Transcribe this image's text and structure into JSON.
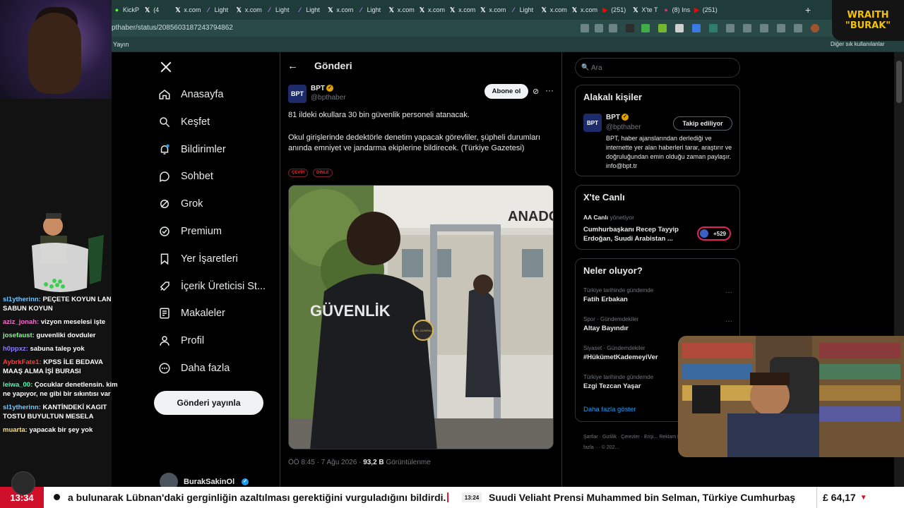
{
  "browser": {
    "tabs": [
      {
        "label": "KickP",
        "icon": "kick-icon",
        "color": "#53fc18"
      },
      {
        "label": "(4",
        "icon": "x-icon",
        "color": "#ffffff"
      },
      {
        "label": "x.com",
        "icon": "x-icon",
        "color": "#ffffff"
      },
      {
        "label": "Light",
        "icon": "feather-icon",
        "color": "#b38cff"
      },
      {
        "label": "x.com",
        "icon": "x-icon",
        "color": "#ffffff"
      },
      {
        "label": "Light",
        "icon": "feather-icon",
        "color": "#b38cff"
      },
      {
        "label": "Light",
        "icon": "feather-icon",
        "color": "#b38cff"
      },
      {
        "label": "x.com",
        "icon": "x-icon",
        "color": "#ffffff"
      },
      {
        "label": "Light",
        "icon": "feather-icon",
        "color": "#b38cff"
      },
      {
        "label": "x.com",
        "icon": "x-icon",
        "color": "#ffffff"
      },
      {
        "label": "x.com",
        "icon": "x-icon",
        "color": "#ffffff"
      },
      {
        "label": "x.com",
        "icon": "x-icon",
        "color": "#ffffff"
      },
      {
        "label": "x.com",
        "icon": "x-icon",
        "color": "#ffffff"
      },
      {
        "label": "Light",
        "icon": "feather-icon",
        "color": "#b38cff"
      },
      {
        "label": "x.com",
        "icon": "x-icon",
        "color": "#ffffff"
      },
      {
        "label": "x.com",
        "icon": "x-icon",
        "color": "#ffffff"
      },
      {
        "label": "(251)",
        "icon": "youtube-icon",
        "color": "#ff0000"
      },
      {
        "label": "X'te T",
        "icon": "x-icon",
        "color": "#ffffff"
      },
      {
        "label": "(8) Ins",
        "icon": "instagram-icon",
        "color": "#e1306c"
      },
      {
        "label": "(251)",
        "icon": "youtube-icon",
        "color": "#ff0000"
      }
    ],
    "new_tab": "+",
    "url": "pthaber/status/2085603187243794862",
    "bookmark_left": "Yayın",
    "bookmark_right": "Diğer sık kullanılanlar"
  },
  "stream": {
    "logo_line1": "WRAITH",
    "logo_line2": "\"BURAK\"",
    "chat": [
      {
        "user": "sl1ytherinn:",
        "text": "PEÇETE KOYUN LAN SABUN KOYUN",
        "color": "#6fc7ff"
      },
      {
        "user": "aziz_jonah:",
        "text": "vizyon meselesi işte",
        "color": "#ff6bd3"
      },
      {
        "user": "josefaust:",
        "text": "guvenliki dovduler",
        "color": "#7dff8a"
      },
      {
        "user": "h0ppxz:",
        "text": "sabuna talep yok",
        "color": "#8a7dff"
      },
      {
        "user": "AybrkFate1:",
        "text": "KPSS İLE BEDAVA MAAŞ ALMA İŞİ BURASI",
        "color": "#ff3b3b"
      },
      {
        "user": "leiwa_00:",
        "text": "Çocuklar denetlensin. kim ne yapıyor, ne gibi bir sıkıntısı var",
        "color": "#47ffb0"
      },
      {
        "user": "sl1ytherinn:",
        "text": "KANTİNDEKİ KAGIT TOSTU BUYULTUN MESELA",
        "color": "#6fc7ff"
      },
      {
        "user": "muarta:",
        "text": "yapacak bir şey yok",
        "color": "#ffe066"
      }
    ]
  },
  "nav": {
    "items": [
      {
        "label": "Anasayfa",
        "icon": "home-icon"
      },
      {
        "label": "Keşfet",
        "icon": "search-icon"
      },
      {
        "label": "Bildirimler",
        "icon": "bell-icon"
      },
      {
        "label": "Sohbet",
        "icon": "chat-icon"
      },
      {
        "label": "Grok",
        "icon": "grok-icon"
      },
      {
        "label": "Premium",
        "icon": "premium-icon"
      },
      {
        "label": "Yer İşaretleri",
        "icon": "bookmark-icon"
      },
      {
        "label": "İçerik Üreticisi St...",
        "icon": "rocket-icon"
      },
      {
        "label": "Makaleler",
        "icon": "article-icon"
      },
      {
        "label": "Profil",
        "icon": "profile-icon"
      },
      {
        "label": "Daha fazla",
        "icon": "more-circle-icon"
      }
    ],
    "post_button": "Gönderi yayınla",
    "account_name": "BurakSakinOl"
  },
  "post": {
    "header": "Gönderi",
    "author_name": "BPT",
    "author_handle": "@bpthaber",
    "avatar_text": "BPT",
    "subscribe": "Abone ol",
    "text1": "81 ildeki okullara 30 bin güvenlik personeli atanacak.",
    "text2": "Okul girişlerinde dedektörle denetim yapacak görevliler, şüpheli durumları anında emniyet ve jandarma ekiplerine bildirecek. (Türkiye Gazetesi)",
    "chip_translate": "ÇEVİR",
    "chip_listen": "DİNLE",
    "image_sign": "ANADO",
    "image_vest": "GÜVENLİK",
    "image_badge": "ÖZEL GÜVENLİK",
    "time": "ÖÖ 8:45 · 7 Ağu 2026 ·",
    "views_count": "93,2 B",
    "views_label": "Görüntülenme"
  },
  "sidebar": {
    "search_placeholder": "Ara",
    "related_title": "Alakalı kişiler",
    "related_name": "BPT",
    "related_handle": "@bpthaber",
    "related_avatar": "BPT",
    "related_follow": "Takip ediliyor",
    "related_bio": "BPT, haber ajanslarından derlediği ve internette yer alan haberleri tarar, araştırır ve doğruluğundan emin olduğu zaman paylaşır. info@bpt.tr",
    "live_title": "X'te Canlı",
    "live_source": "AA Canlı",
    "live_status": "yönetiyor",
    "live_text": "Cumhurbaşkanı Recep Tayyip Erdoğan, Suudi Arabistan ...",
    "live_count": "+529",
    "trends_title": "Neler oluyor?",
    "trends": [
      {
        "context": "Türkiye tarihinde gündemde",
        "title": "Fatih Erbakan"
      },
      {
        "context": "Spor · Gündemdekiler",
        "title": "Altay Bayındır"
      },
      {
        "context": "Siyaset · Gündemdekiler",
        "title": "#HükümetKademeyiVer"
      },
      {
        "context": "Türkiye tarihinde gündemde",
        "title": "Ezgi Tezcan Yaşar"
      }
    ],
    "show_more": "Daha fazla göster",
    "footer": "Şartlar · Gizlilik · Çerezler · Erişi... Reklam Bilgileri · Daha fazla ··· © 202..."
  },
  "ticker": {
    "clock": "13:34",
    "text1": "a bulunarak Lübnan'daki gerginliğin azaltılması gerektiğini vurguladığını bildirdi.",
    "separator": "|",
    "time2": "13:24",
    "text2": "Suudi Veliaht Prensi Muhammed bin Selman, Türkiye Cumhurbaş",
    "price": "£ 64,17",
    "price_arrow": "▼"
  }
}
